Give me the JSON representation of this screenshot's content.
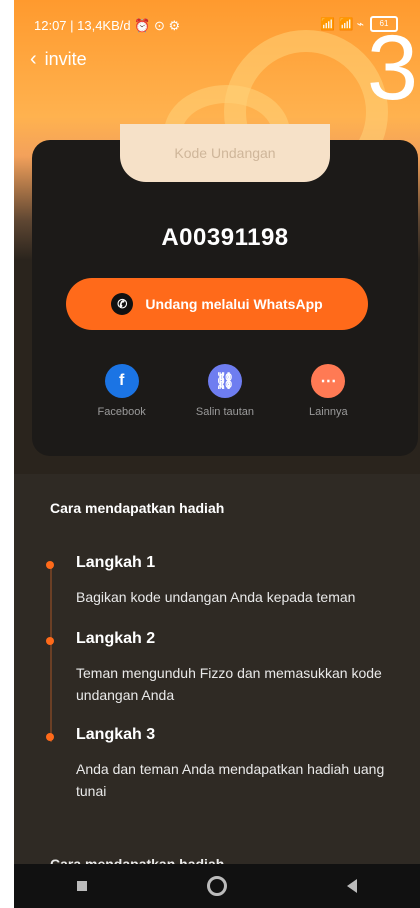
{
  "status_bar": {
    "left": "12:07 | 13,4KB/d ⏰ ⊙ ⚙",
    "right_icons": "📶 📶 ⌁",
    "battery": "61"
  },
  "header": {
    "back_label": "invite",
    "hero_number": "3"
  },
  "invite_card": {
    "tab_label": "Kode Undangan",
    "code": "A00391198",
    "whatsapp_button": "Undang melalui WhatsApp",
    "share": [
      {
        "label": "Facebook",
        "icon": "facebook-icon",
        "color": "#1b74e4",
        "glyph": "f"
      },
      {
        "label": "Salin tautan",
        "icon": "link-icon",
        "color": "#6e7df0",
        "glyph": "⛓"
      },
      {
        "label": "Lainnya",
        "icon": "more-icon",
        "color": "#ff7a54",
        "glyph": "⋯"
      }
    ]
  },
  "steps": {
    "title": "Cara mendapatkan hadiah",
    "items": [
      {
        "title": "Langkah 1",
        "desc": "Bagikan kode undangan Anda kepada teman"
      },
      {
        "title": "Langkah 2",
        "desc": "Teman mengunduh Fizzo dan memasukkan kode undangan Anda"
      },
      {
        "title": "Langkah 3",
        "desc": "Anda dan teman Anda mendapatkan hadiah uang tunai"
      }
    ],
    "next_section_title": "Cara mendapatkan hadiah"
  }
}
